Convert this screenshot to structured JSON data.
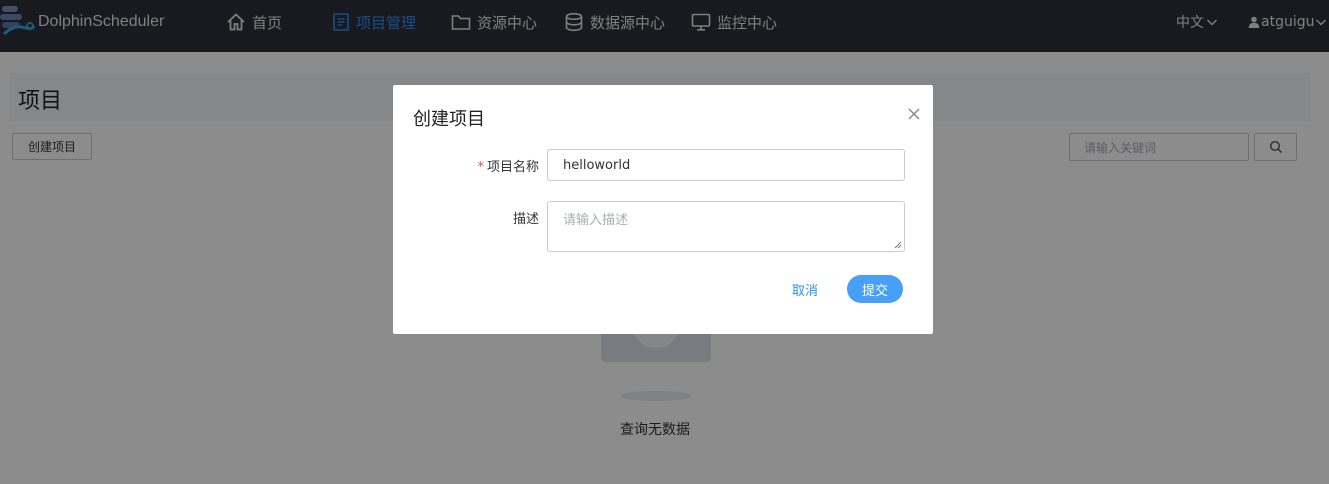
{
  "navbar": {
    "brand": "DolphinScheduler",
    "items": [
      {
        "label": "首页",
        "icon": "home-icon",
        "active": false
      },
      {
        "label": "项目管理",
        "icon": "document-icon",
        "active": true
      },
      {
        "label": "资源中心",
        "icon": "folder-icon",
        "active": false
      },
      {
        "label": "数据源中心",
        "icon": "database-icon",
        "active": false
      },
      {
        "label": "监控中心",
        "icon": "monitor-icon",
        "active": false
      }
    ],
    "language": "中文",
    "user": "atguigu",
    "bg_color": "#2d303a",
    "active_color": "#2b8ff3"
  },
  "page": {
    "title": "项目",
    "create_button": "创建项目",
    "search_placeholder": "请输入关键词",
    "empty_text": "查询无数据"
  },
  "modal": {
    "title": "创建项目",
    "name_label": "项目名称",
    "required_mark": "*",
    "name_value": "helloworld",
    "desc_label": "描述",
    "desc_placeholder": "请输入描述",
    "cancel_label": "取消",
    "submit_label": "提交",
    "primary_color": "#47a0f5"
  }
}
